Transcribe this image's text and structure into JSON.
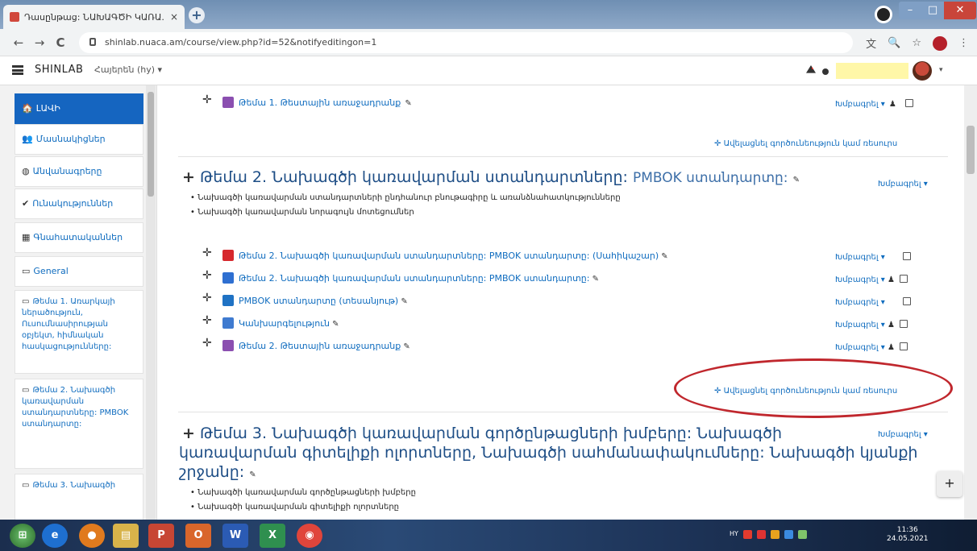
{
  "browser": {
    "tab_title": "Դասընթաց: ՆԱԽԱԳԾԻ ԿԱՌԱ...",
    "tab_close": "×",
    "new_tab": "+",
    "url": "shinlab.nuaca.am/course/view.php?id=52&notifyeditingon=1",
    "back": "←",
    "forward": "→",
    "reload": "C",
    "icons": {
      "translate": "文",
      "zoom": "🔍",
      "star": "☆",
      "menu": "⋮"
    }
  },
  "navbar": {
    "brand": "SHINLAB",
    "language": "Հայերեն (hy) ▾",
    "user_caret": "▾"
  },
  "sidebar": {
    "items": [
      {
        "icon": "🏠",
        "label": "ԼԱՎԻ",
        "active": true
      },
      {
        "icon": "👥",
        "label": "Մասնակիցներ"
      },
      {
        "icon": "◍",
        "label": "Անվանագրերը"
      },
      {
        "icon": "✔",
        "label": "Ունակություններ"
      },
      {
        "icon": "▦",
        "label": "Գնահատականներ"
      },
      {
        "icon": "▭",
        "label": "General"
      },
      {
        "icon": "▭",
        "label": "Թեմա 1. Առարկայի ներածություն, Ուսումնասիրության օբյեկտ, հիմնական հասկացությունները:"
      },
      {
        "icon": "▭",
        "label": "Թեմա 2. Նախագծի կառավարման ստանդարտները: PMBOK ստանդարտը:"
      },
      {
        "icon": "▭",
        "label": "Թեմա 3. Նախագծի"
      }
    ]
  },
  "main": {
    "top_activity": {
      "label": "Թեմա 1. Թեստային առաջադրանք",
      "edit": "Խմբագրել ▾"
    },
    "add_activity": "Ավելացնել գործունեություն կամ ռեսուրս",
    "section2": {
      "title_prefix": "Թեմա 2.",
      "title_rest": "Նախագծի կառավարման ստանդարտները:",
      "title_suffix": "PMBOK ստանդարտը:",
      "edit": "Խմբագրել ▾",
      "bullets": [
        "Նախագծի կառավարման ստանդարտների ընդհանուր բնութագիրը և առանձնահատկությունները",
        "Նախագծի կառավարման նորագույն մոտեցումներ"
      ],
      "activities": [
        {
          "label": "Թեմա 2. Նախագծի կառավարման ստանդարտները: PMBOK ստանդարտը: (Սահիկաշար)",
          "edit": "Խմբագրել ▾",
          "person": false,
          "icon_color": "#d6282d"
        },
        {
          "label": "Թեմա 2. Նախագծի կառավարման ստանդարտները: PMBOK ստանդարտը:",
          "edit": "Խմբագրել ▾",
          "person": true,
          "icon_color": "#2e6fd1"
        },
        {
          "label": "PMBOK ստանդարտը (տեսանյութ)",
          "edit": "Խմբագրել ▾",
          "person": false,
          "icon_color": "#1f72c4"
        },
        {
          "label": "Կանխարգելություն",
          "edit": "Խմբագրել ▾",
          "person": true,
          "icon_color": "#3f7bd0"
        },
        {
          "label": "Թեմա 2. Թեստային առաջադրանք",
          "edit": "Խմբագրել ▾",
          "person": true,
          "icon_color": "#8b4fb0"
        }
      ]
    },
    "section3": {
      "title_line1": "Թեմա 3. Նախագծի կառավարման գործընթացների խմբերը: Նախագծի",
      "title_line2": "կառավարման գիտելիքի ոլորտները, Նախագծի սահմանափակումները: Նախագծի կյանքի",
      "title_line3": "շրջանը:",
      "edit": "Խմբագրել ▾",
      "bullets": [
        "Նախագծի կառավարման գործընթացների խմբերը",
        "Նախագծի կառավարման գիտելիքի ոլորտները"
      ]
    },
    "fab": "+"
  },
  "taskbar": {
    "buttons": [
      "⊞",
      "e",
      "●",
      "▤",
      "P",
      "O",
      "W",
      "X",
      "◉"
    ],
    "lang": "HY",
    "time": "11:36",
    "date": "24.05.2021"
  },
  "colors": {
    "accent": "#1565c0",
    "link": "#0f6cbf",
    "highlight_oval": "#c0272d"
  }
}
